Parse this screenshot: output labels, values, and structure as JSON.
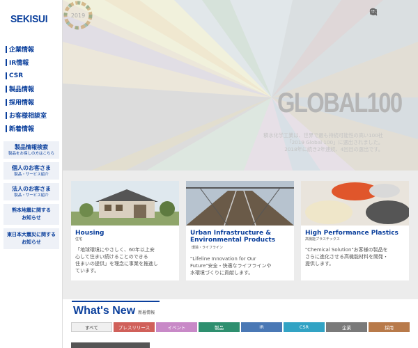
{
  "brand": {
    "logo": "SEKISUI",
    "accent": "#0a3f9c"
  },
  "nav": {
    "items": [
      {
        "label": "企業情報"
      },
      {
        "label": "IR情報"
      },
      {
        "label": "CSR"
      },
      {
        "label": "製品情報"
      },
      {
        "label": "採用情報"
      },
      {
        "label": "お客様相談室"
      },
      {
        "label": "新着情報"
      }
    ]
  },
  "side_buttons": {
    "product_search": {
      "title": "製品情報検索",
      "sub": "製品をお探しの方はこちら"
    },
    "individual": {
      "title": "個人のお客さま",
      "sub": "製品・サービス紹介"
    },
    "corporate": {
      "title": "法人のお客さま",
      "sub": "製品・サービス紹介"
    },
    "kumamoto": {
      "line1": "熊本地震に関する",
      "line2": "お知らせ"
    },
    "tohoku": {
      "line1": "東日本大震災に関する",
      "line2": "お知らせ"
    }
  },
  "header_icons": [
    "search-icon",
    "globe-icon",
    "menu-icon"
  ],
  "hero": {
    "badge_year": "2019",
    "title": "GLOBAL100",
    "copy": [
      "積水化学工業は、世界で最も持続可能性の高い100社",
      "「2019 Global 100」に選出されました。",
      "2018年に続き2年連続、4回目の選出です。"
    ]
  },
  "slider": {
    "count": 6,
    "active_index": 5
  },
  "cards": [
    {
      "title": "Housing",
      "title2": "",
      "category": "住宅",
      "desc": [
        "「地球環境にやさしく、60年以上安",
        "心して住まい続けることのできる",
        "住まいの提供」を理念に事業を推進し",
        "ています。"
      ]
    },
    {
      "title": "Urban Infrastructure &",
      "title2": "Environmental Products",
      "category": "環境・ライフライン",
      "desc": [
        "\"Lifeline Innovation for Our",
        "Future\"安全・快適なライフラインや",
        "水環境づくりに貢献します。"
      ]
    },
    {
      "title": "High Performance Plastics",
      "title2": "",
      "category": "高機能プラスチックス",
      "desc": [
        "\"Chemical Solution\"お客様の製品を",
        "さらに進化させる高機能材料を開発・",
        "提供します。"
      ]
    }
  ],
  "news": {
    "title": "What's New",
    "subtitle": "新着情報",
    "filters": [
      {
        "label": "すべて",
        "color": "#f0f0f0"
      },
      {
        "label": "プレスリリース",
        "color": "#d0605a"
      },
      {
        "label": "イベント",
        "color": "#c889c7"
      },
      {
        "label": "製品",
        "color": "#2e8f6f"
      },
      {
        "label": "IR",
        "color": "#4a78b5"
      },
      {
        "label": "CSR",
        "color": "#32a3c4"
      },
      {
        "label": "企業",
        "color": "#7a7a7a"
      },
      {
        "label": "採用",
        "color": "#b87a4a"
      }
    ]
  }
}
